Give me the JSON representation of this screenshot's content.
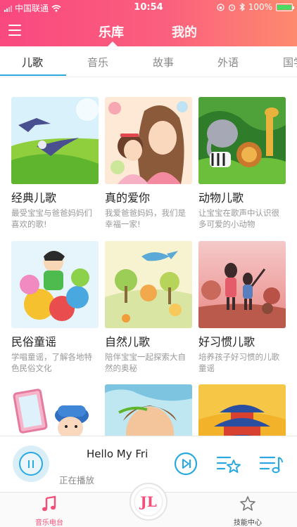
{
  "status_bar": {
    "carrier": "中国联通",
    "time": "10:54",
    "battery": "100%",
    "icons": [
      "signal-icon",
      "wifi-icon",
      "rotation-lock-icon",
      "alarm-icon",
      "bluetooth-icon",
      "battery-icon"
    ]
  },
  "nav": {
    "menu_icon": "menu-icon",
    "tabs": [
      {
        "label": "乐库",
        "active": true
      },
      {
        "label": "我的",
        "active": false
      }
    ]
  },
  "categories": {
    "tabs": [
      {
        "label": "儿歌",
        "active": true
      },
      {
        "label": "音乐",
        "active": false
      },
      {
        "label": "故事",
        "active": false
      },
      {
        "label": "外语",
        "active": false
      },
      {
        "label": "国学",
        "active": false
      }
    ]
  },
  "cards": [
    {
      "title": "经典儿歌",
      "desc": "最受宝宝与爸爸妈妈们喜欢的歌!"
    },
    {
      "title": "真的爱你",
      "desc": "我爱爸爸妈妈，我们是幸福一家!"
    },
    {
      "title": "动物儿歌",
      "desc": "让宝宝在歌声中认识很多可爱的小动物"
    },
    {
      "title": "民俗童谣",
      "desc": "学唱童谣，了解各地特色民俗文化"
    },
    {
      "title": "自然儿歌",
      "desc": "陪伴宝宝一起探索大自然的奥秘"
    },
    {
      "title": "好习惯儿歌",
      "desc": "培养孩子好习惯的儿歌童谣"
    },
    {
      "title": "",
      "desc": ""
    },
    {
      "title": "",
      "desc": ""
    },
    {
      "title": "",
      "desc": ""
    }
  ],
  "player": {
    "song_title": "Hello My Fri",
    "status": "正在播放",
    "icons": [
      "pause-icon",
      "next-track-icon",
      "favorite-list-icon",
      "playlist-icon"
    ]
  },
  "tabbar": {
    "items": [
      {
        "label": "音乐电台",
        "icon": "music-note-icon",
        "active": true
      },
      {
        "label": "",
        "icon": "logo-jl-icon",
        "active": false
      },
      {
        "label": "技能中心",
        "icon": "star-icon",
        "active": false
      }
    ],
    "center_text": "JL"
  },
  "colors": {
    "header_gradient_start": "#f9487f",
    "header_gradient_end": "#fd8a6e",
    "accent_blue": "#2aa9e0",
    "accent_pink": "#f44e79"
  }
}
